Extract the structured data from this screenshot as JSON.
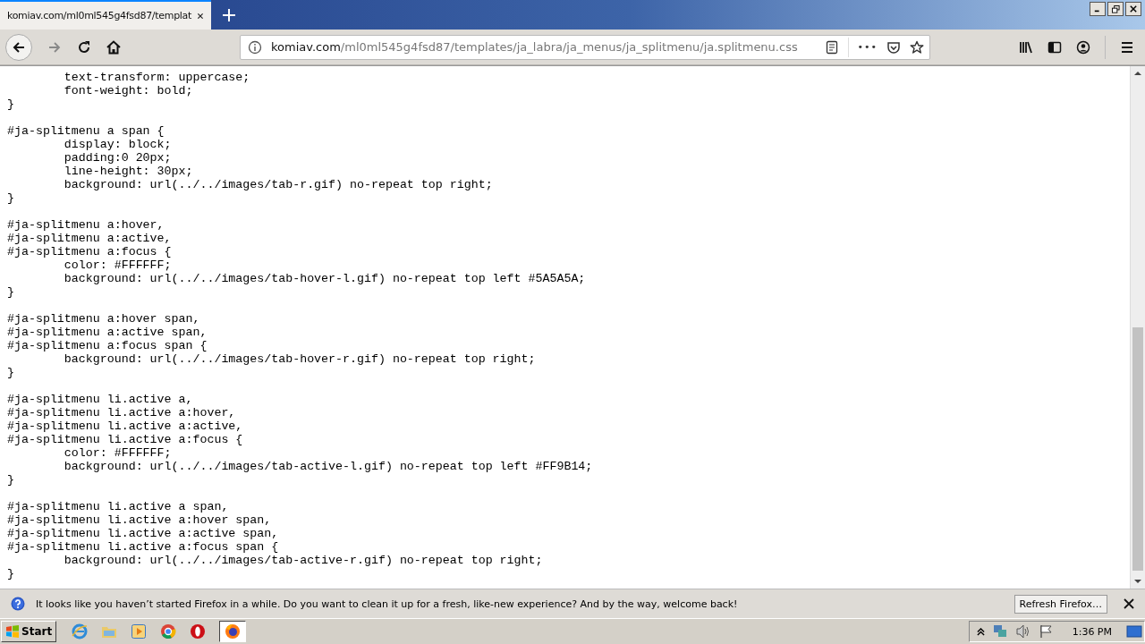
{
  "tabs": [
    {
      "title": "komiav.com/ml0ml545g4fsd87/templat",
      "selected": true
    }
  ],
  "url": {
    "domain": "komiav.com",
    "path": "/ml0ml545g4fsd87/templates/ja_labra/ja_menus/ja_splitmenu/ja.splitmenu.css"
  },
  "toolbar_overflow": "•••",
  "source_blocks": [
    {
      "lines": [
        "\ttext-transform: uppercase;",
        "\tfont-weight: bold;",
        "}"
      ]
    },
    {
      "lines": [
        "#ja-splitmenu a span {",
        "\tdisplay: block;",
        "\tpadding:0 20px;",
        "\tline-height: 30px;",
        "\tbackground: url(../../images/tab-r.gif) no-repeat top right;",
        "}"
      ]
    },
    {
      "lines": [
        "#ja-splitmenu a:hover,",
        "#ja-splitmenu a:active,",
        "#ja-splitmenu a:focus {",
        "\tcolor: #FFFFFF;",
        "\tbackground: url(../../images/tab-hover-l.gif) no-repeat top left #5A5A5A;",
        "}"
      ]
    },
    {
      "lines": [
        "#ja-splitmenu a:hover span,",
        "#ja-splitmenu a:active span,",
        "#ja-splitmenu a:focus span {",
        "\tbackground: url(../../images/tab-hover-r.gif) no-repeat top right;",
        "}"
      ]
    },
    {
      "lines": [
        "#ja-splitmenu li.active a,",
        "#ja-splitmenu li.active a:hover,",
        "#ja-splitmenu li.active a:active,",
        "#ja-splitmenu li.active a:focus {",
        "\tcolor: #FFFFFF;",
        "\tbackground: url(../../images/tab-active-l.gif) no-repeat top left #FF9B14;",
        "}"
      ]
    },
    {
      "lines": [
        "#ja-splitmenu li.active a span,",
        "#ja-splitmenu li.active a:hover span,",
        "#ja-splitmenu li.active a:active span,",
        "#ja-splitmenu li.active a:focus span {",
        "\tbackground: url(../../images/tab-active-r.gif) no-repeat top right;",
        "}"
      ]
    }
  ],
  "notification": {
    "message": "It looks like you haven’t started Firefox in a while. Do you want to clean it up for a fresh, like-new experience? And by the way, welcome back!",
    "button": "Refresh Firefox…"
  },
  "taskbar": {
    "start": "Start",
    "clock": "1:36 PM"
  }
}
